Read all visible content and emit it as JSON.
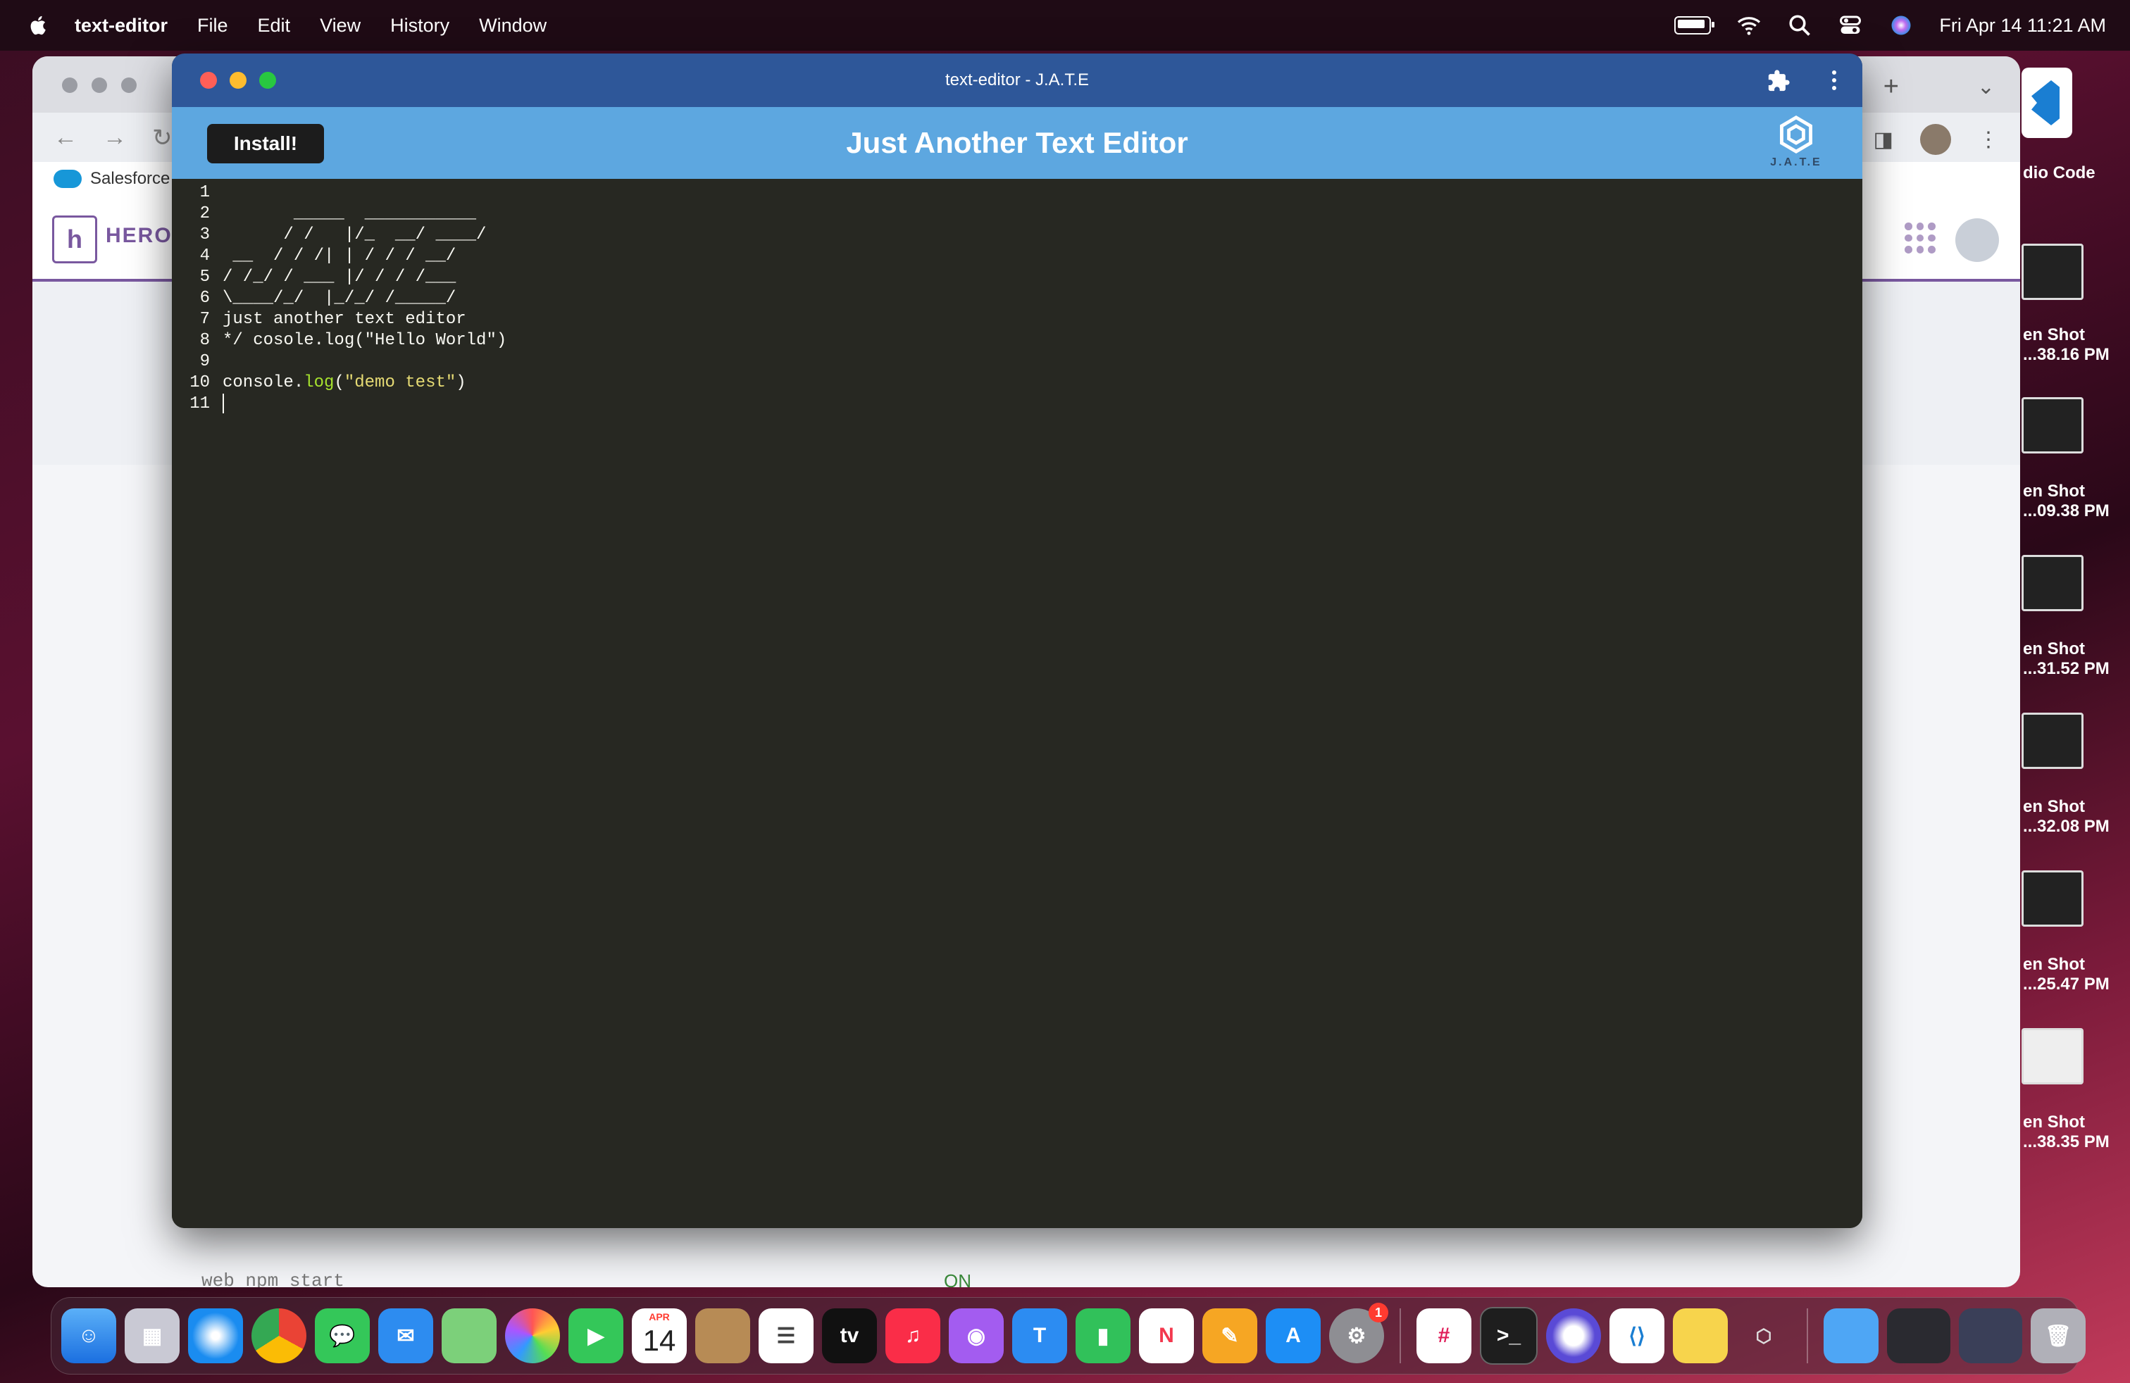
{
  "menubar": {
    "app_name": "text-editor",
    "menus": [
      "File",
      "Edit",
      "View",
      "History",
      "Window"
    ],
    "clock": "Fri Apr 14  11:21 AM"
  },
  "background_window": {
    "bookmark": "Salesforce",
    "heroku_text": "HEROI",
    "bottom_text": "web  npm start",
    "bottom_status": "ON"
  },
  "desktop": {
    "items": [
      {
        "label": "dio Code"
      },
      {
        "label": "en Shot\n...38.16 PM"
      },
      {
        "label": "en Shot\n...09.38 PM"
      },
      {
        "label": "en Shot\n...31.52 PM"
      },
      {
        "label": "en Shot\n...32.08 PM"
      },
      {
        "label": "en Shot\n...25.47 PM"
      },
      {
        "label": "en Shot\n...38.35 PM"
      }
    ]
  },
  "app": {
    "window_title": "text-editor - J.A.T.E",
    "header_title": "Just Another Text Editor",
    "install_label": "Install!",
    "logo_text": "J.A.T.E",
    "lines": [
      {
        "num": "1",
        "text": ""
      },
      {
        "num": "2",
        "text": "       _____  ___________"
      },
      {
        "num": "3",
        "text": "      / /   |/_  __/ ____/"
      },
      {
        "num": "4",
        "text": " __  / / /| | / / / __/"
      },
      {
        "num": "5",
        "text": "/ /_/ / ___ |/ / / /___"
      },
      {
        "num": "6",
        "text": "\\____/_/  |_/_/ /_____/"
      },
      {
        "num": "7",
        "text": "just another text editor"
      },
      {
        "num": "8",
        "text": "*/ cosole.log(\"Hello World\")"
      },
      {
        "num": "9",
        "text": ""
      },
      {
        "num": "10",
        "text": ""
      },
      {
        "num": "11",
        "text": ""
      }
    ],
    "code_line_10": {
      "obj": "console.",
      "fn": "log",
      "open": "(",
      "str": "\"demo test\"",
      "close": ")"
    }
  },
  "dock": {
    "calendar_month": "APR",
    "calendar_day": "14",
    "tv_label": "tv",
    "settings_badge": "1",
    "icons": [
      "finder-icon",
      "launchpad-icon",
      "safari-icon",
      "chrome-icon",
      "messages-icon",
      "mail-icon",
      "maps-icon",
      "photos-icon",
      "facetime-icon",
      "calendar-icon",
      "contacts-icon",
      "reminders-icon",
      "tv-icon",
      "music-icon",
      "podcasts-icon",
      "keynote-icon",
      "numbers-icon",
      "news-icon",
      "pages-icon",
      "appstore-icon",
      "settings-icon",
      "slack-icon",
      "terminal-icon",
      "screenshot-tool-icon",
      "vscode-icon",
      "notes-icon",
      "jate-icon",
      "folder-icon",
      "recent-windows-icon",
      "trash-icon"
    ]
  }
}
